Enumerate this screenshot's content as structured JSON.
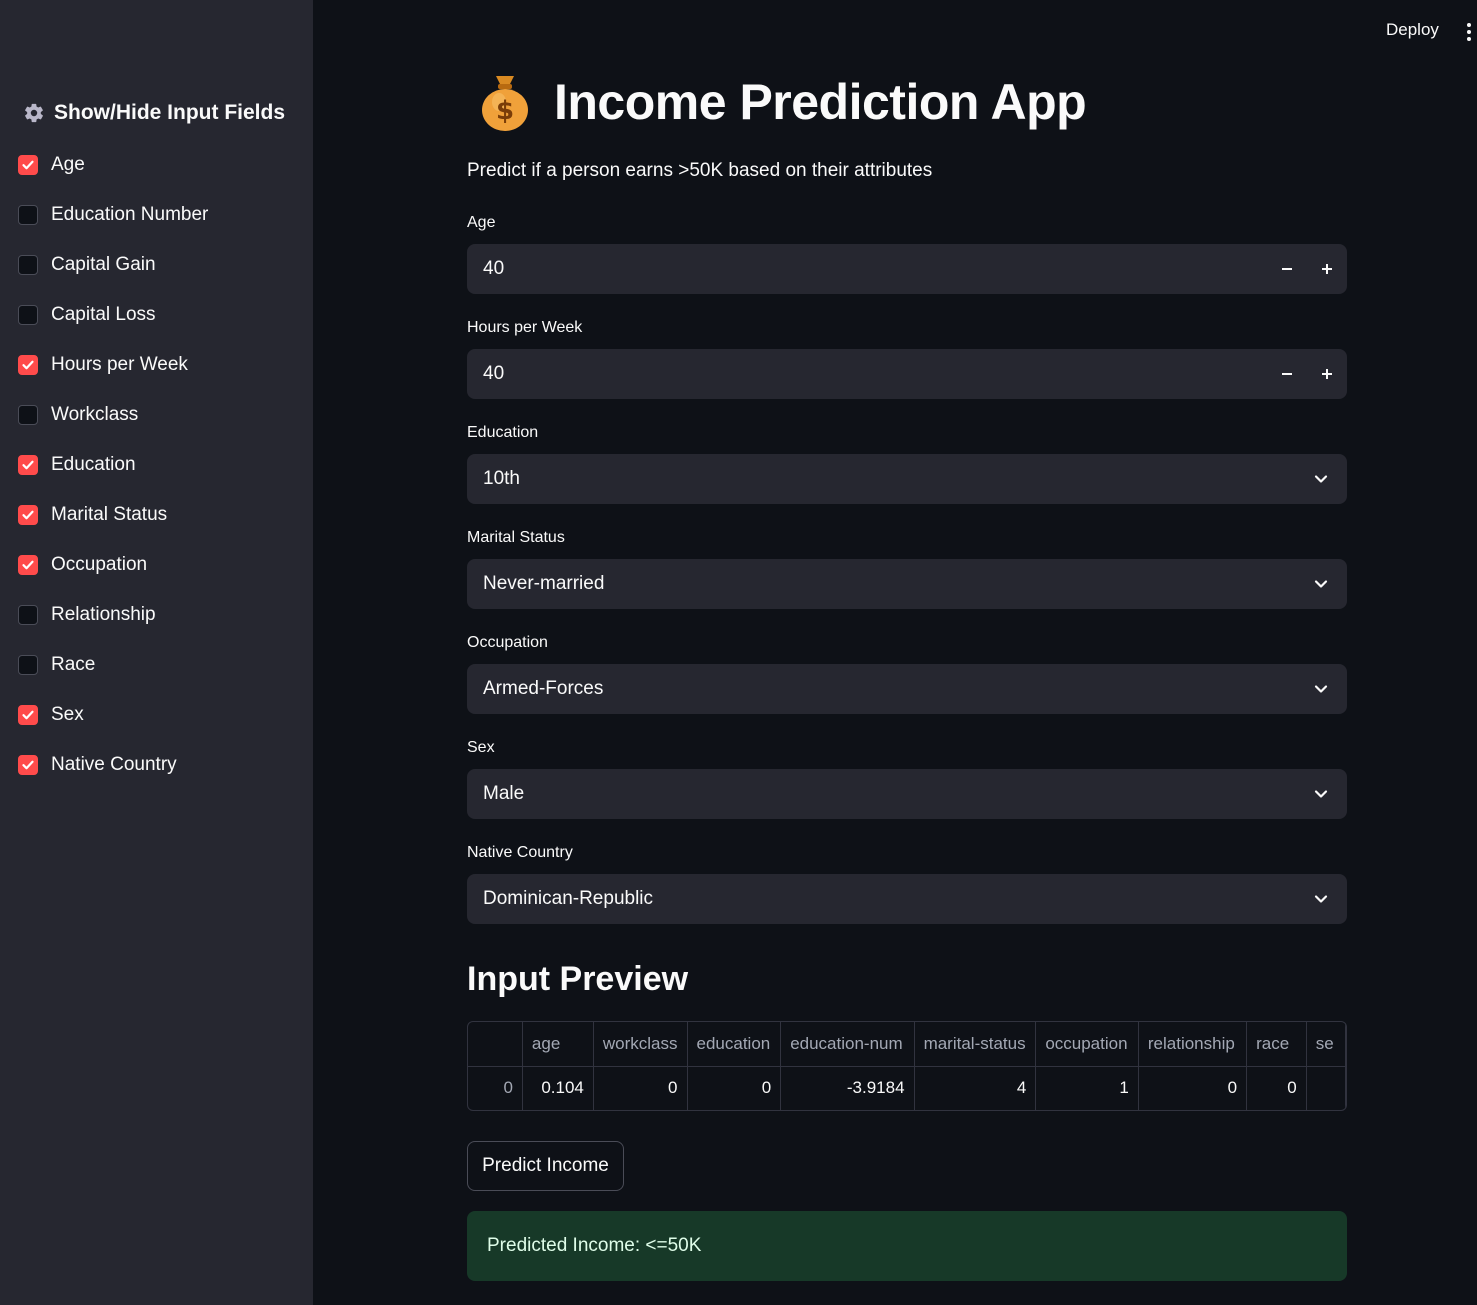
{
  "header": {
    "deploy_label": "Deploy",
    "menu_icon": "kebab-menu-icon"
  },
  "sidebar": {
    "title": "Show/Hide Input Fields",
    "title_icon": "gear-icon",
    "items": [
      {
        "label": "Age",
        "checked": true
      },
      {
        "label": "Education Number",
        "checked": false
      },
      {
        "label": "Capital Gain",
        "checked": false
      },
      {
        "label": "Capital Loss",
        "checked": false
      },
      {
        "label": "Hours per Week",
        "checked": true
      },
      {
        "label": "Workclass",
        "checked": false
      },
      {
        "label": "Education",
        "checked": true
      },
      {
        "label": "Marital Status",
        "checked": true
      },
      {
        "label": "Occupation",
        "checked": true
      },
      {
        "label": "Relationship",
        "checked": false
      },
      {
        "label": "Race",
        "checked": false
      },
      {
        "label": "Sex",
        "checked": true
      },
      {
        "label": "Native Country",
        "checked": true
      }
    ]
  },
  "main": {
    "title": "Income Prediction App",
    "title_icon": "money-bag-icon",
    "subtitle": "Predict if a person earns >50K based on their attributes",
    "fields": {
      "age": {
        "label": "Age",
        "value": "40"
      },
      "hours": {
        "label": "Hours per Week",
        "value": "40"
      },
      "education": {
        "label": "Education",
        "value": "10th"
      },
      "marital": {
        "label": "Marital Status",
        "value": "Never-married"
      },
      "occupation": {
        "label": "Occupation",
        "value": "Armed-Forces"
      },
      "sex": {
        "label": "Sex",
        "value": "Male"
      },
      "country": {
        "label": "Native Country",
        "value": "Dominican-Republic"
      }
    },
    "preview_title": "Input Preview",
    "table": {
      "columns": [
        "",
        "age",
        "workclass",
        "education",
        "education-num",
        "marital-status",
        "occupation",
        "relationship",
        "race",
        "se"
      ],
      "rows": [
        [
          "0",
          "0.104",
          "0",
          "0",
          "-3.9184",
          "4",
          "1",
          "0",
          "0",
          ""
        ]
      ]
    },
    "predict_label": "Predict Income",
    "result": "Predicted Income: <=50K"
  },
  "colors": {
    "accent": "#ff4b4b",
    "background": "#0e1117",
    "sidebar": "#262730",
    "success_bg": "#173928"
  }
}
